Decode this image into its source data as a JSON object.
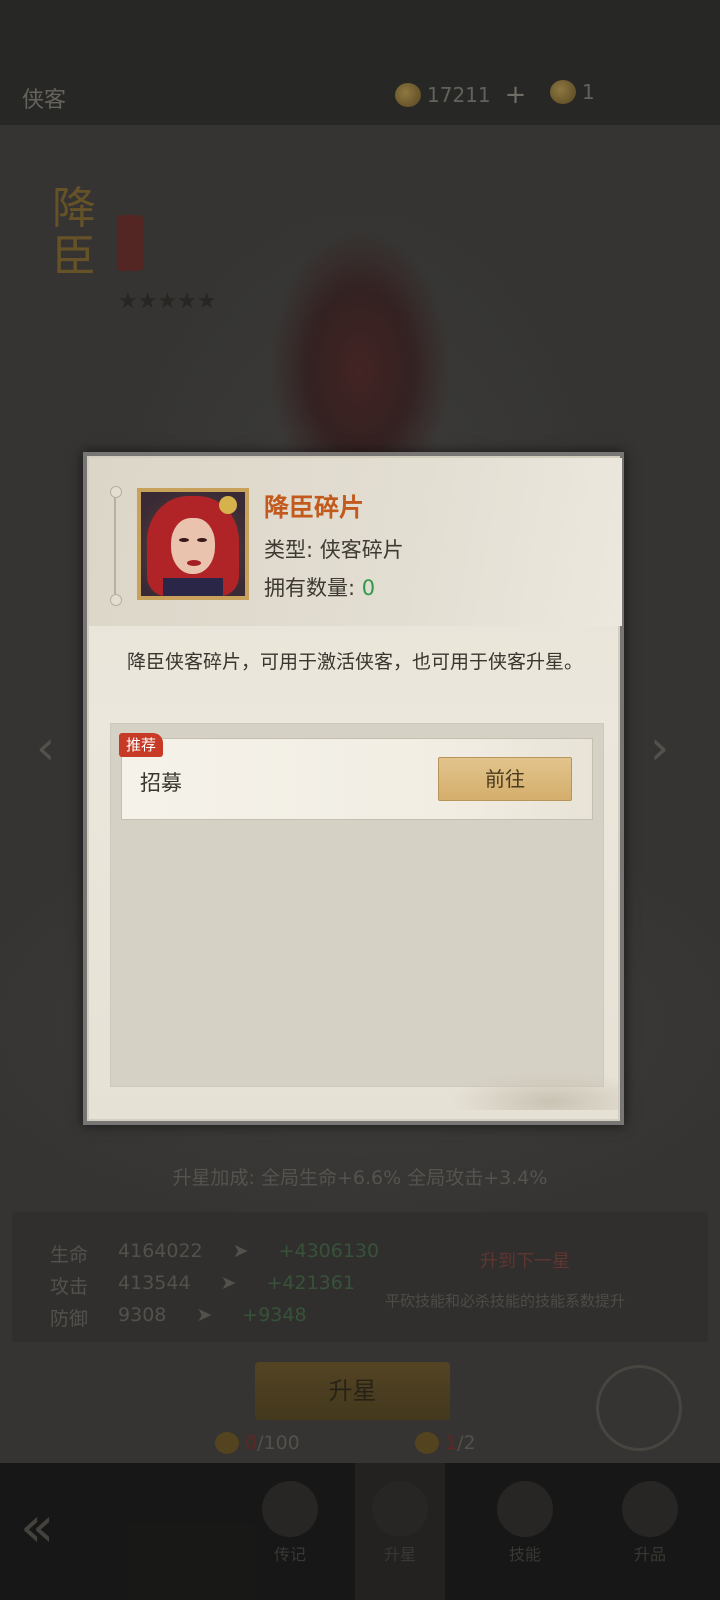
{
  "background": {
    "page_title": "侠客",
    "resources": [
      {
        "icon": "gold-ingot-icon",
        "value": "17211",
        "has_plus": true
      },
      {
        "icon": "gold-coin-icon",
        "value": "1",
        "has_plus": false
      }
    ],
    "hero_name": "降臣",
    "upgrade_bonus": {
      "label": "升星加成:",
      "life": "全局生命+6.6%",
      "attack": "全局攻击+3.4%"
    },
    "stats": [
      {
        "name": "生命",
        "from": "4164022",
        "to": "+4306130"
      },
      {
        "name": "攻击",
        "from": "413544",
        "to": "+421361"
      },
      {
        "name": "防御",
        "from": "9308",
        "to": "+9348"
      }
    ],
    "next_star_tip": "升到下一星",
    "next_star_desc": "平砍技能和必杀技能的技能系数提升",
    "upgrade_button": "升星",
    "costs": [
      {
        "current": "0",
        "required": "/100"
      },
      {
        "current": "1",
        "required": "/2"
      }
    ],
    "bottom_nav": [
      "传记",
      "升星",
      "技能",
      "升品"
    ]
  },
  "popup": {
    "item_name": "降臣碎片",
    "type_label": "类型:",
    "type_value": "侠客碎片",
    "count_label": "拥有数量:",
    "count_value": "0",
    "description": "降臣侠客碎片，可用于激活侠客，也可用于侠客升星。",
    "sources": [
      {
        "tag": "推荐",
        "label": "招募",
        "button": "前往"
      }
    ]
  },
  "colors": {
    "item_name": "#c15a1c",
    "count_value": "#2e9a4a",
    "recommend_tag": "#c73a26",
    "go_button": "#d4ae6c"
  }
}
